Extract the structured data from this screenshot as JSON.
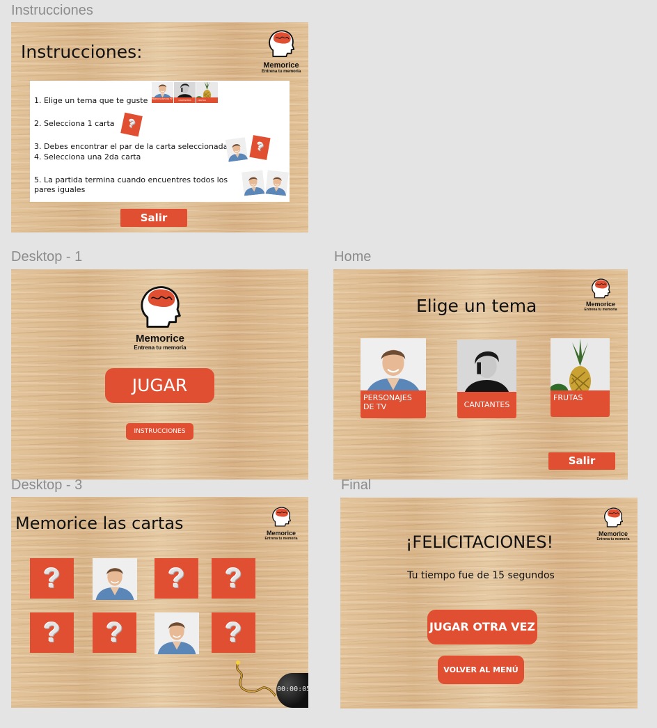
{
  "brand": {
    "name": "Memorice",
    "tagline": "Entrena tu memoria"
  },
  "colors": {
    "accent": "#e04f32",
    "canvas": "#e4e4e4",
    "wood": "#ddbb91",
    "text": "#111111"
  },
  "frames": {
    "instrucciones": {
      "label": "Instrucciones",
      "title": "Instrucciones:",
      "steps": [
        "1. Elige un tema que te guste",
        "2.  Selecciona 1 carta",
        "3. Debes  encontrar el par de la carta seleccionada",
        "4. Selecciona una 2da carta",
        "5. La partida termina cuando encuentres todos los pares iguales"
      ],
      "mini_themes": [
        "PERSONAJES DE TV",
        "CANTANTES",
        "FRUTAS"
      ],
      "exit_button": "Salir"
    },
    "desktop1": {
      "label": "Desktop - 1",
      "play_button": "JUGAR",
      "instructions_button": "INSTRUCCIONES"
    },
    "home": {
      "label": "Home",
      "title": "Elige un tema",
      "themes": [
        {
          "label": "PERSONAJES DE TV",
          "icon": "man-portrait"
        },
        {
          "label": "CANTANTES",
          "icon": "singer-portrait"
        },
        {
          "label": "FRUTAS",
          "icon": "pineapple"
        }
      ],
      "exit_button": "Salir"
    },
    "desktop3": {
      "label": "Desktop - 3",
      "title": "Memorice las cartas",
      "cards": [
        "hidden",
        "revealed",
        "hidden",
        "hidden",
        "hidden",
        "hidden",
        "revealed",
        "hidden"
      ],
      "hidden_symbol": "?",
      "timer": "00:00:05"
    },
    "final": {
      "label": "Final",
      "title": "¡FELICITACIONES!",
      "message": "Tu tiempo fue de 15  segundos",
      "play_again_button": "JUGAR OTRA VEZ",
      "menu_button": "VOLVER AL MENÚ"
    }
  }
}
